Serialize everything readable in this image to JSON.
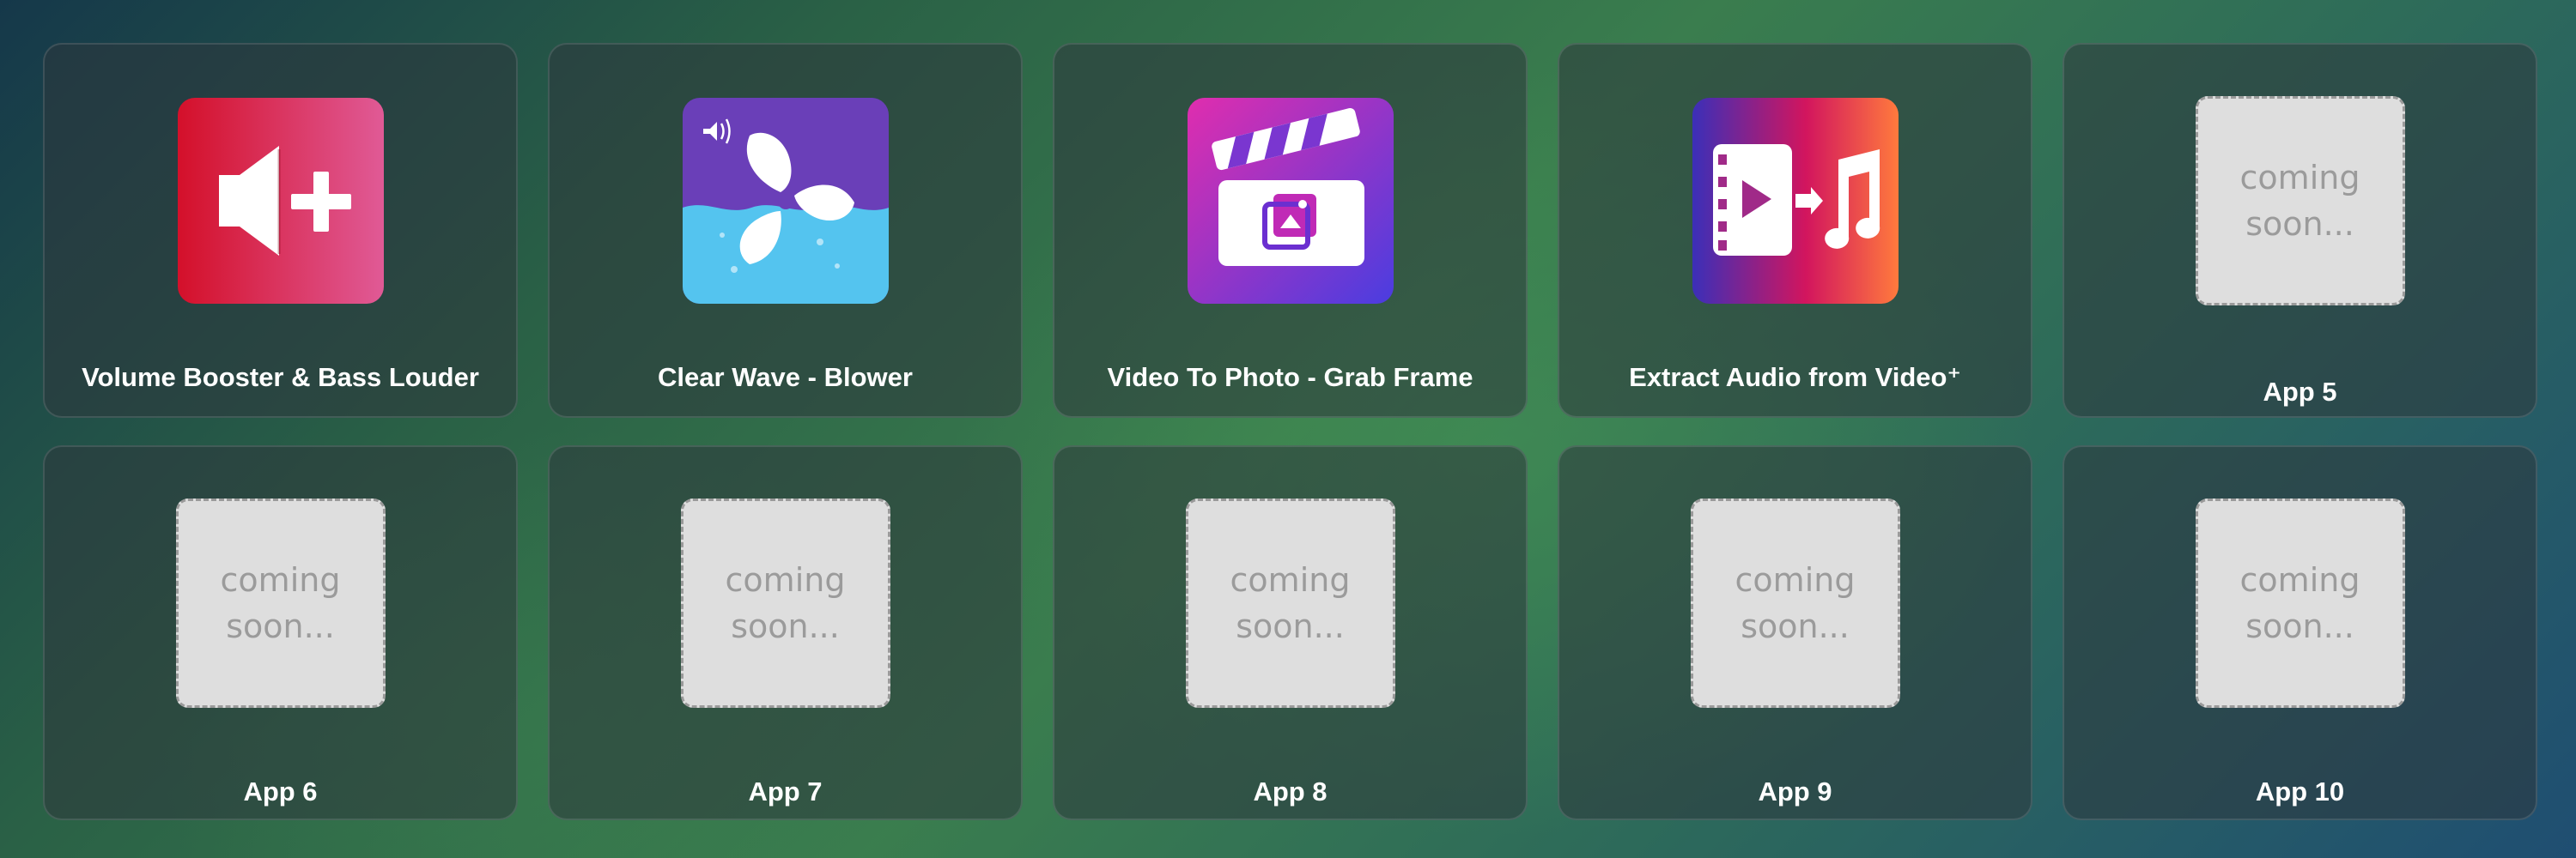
{
  "apps": [
    {
      "name": "Volume Booster & Bass Louder",
      "icon": "volume-plus-icon",
      "colors": {
        "from": "#d4102a",
        "to": "#e05a96"
      }
    },
    {
      "name": "Clear Wave - Blower",
      "icon": "fan-icon",
      "colors": {
        "top": "#6a3fb8",
        "water": "#54c4ef"
      }
    },
    {
      "name": "Video To Photo - Grab Frame",
      "icon": "clapperboard-icon",
      "colors": {
        "from": "#e02dae",
        "to": "#4a3de0"
      }
    },
    {
      "name": "Extract Audio from Video⁺",
      "icon": "video-to-music-icon",
      "colors": {
        "from": "#3b2fb8",
        "mid": "#d2155e",
        "to": "#ff7a3d"
      }
    },
    {
      "name": "App 5",
      "placeholder": "coming soon..."
    },
    {
      "name": "App 6",
      "placeholder": "coming soon..."
    },
    {
      "name": "App 7",
      "placeholder": "coming soon..."
    },
    {
      "name": "App 8",
      "placeholder": "coming soon..."
    },
    {
      "name": "App 9",
      "placeholder": "coming soon..."
    },
    {
      "name": "App 10",
      "placeholder": "coming soon..."
    }
  ]
}
